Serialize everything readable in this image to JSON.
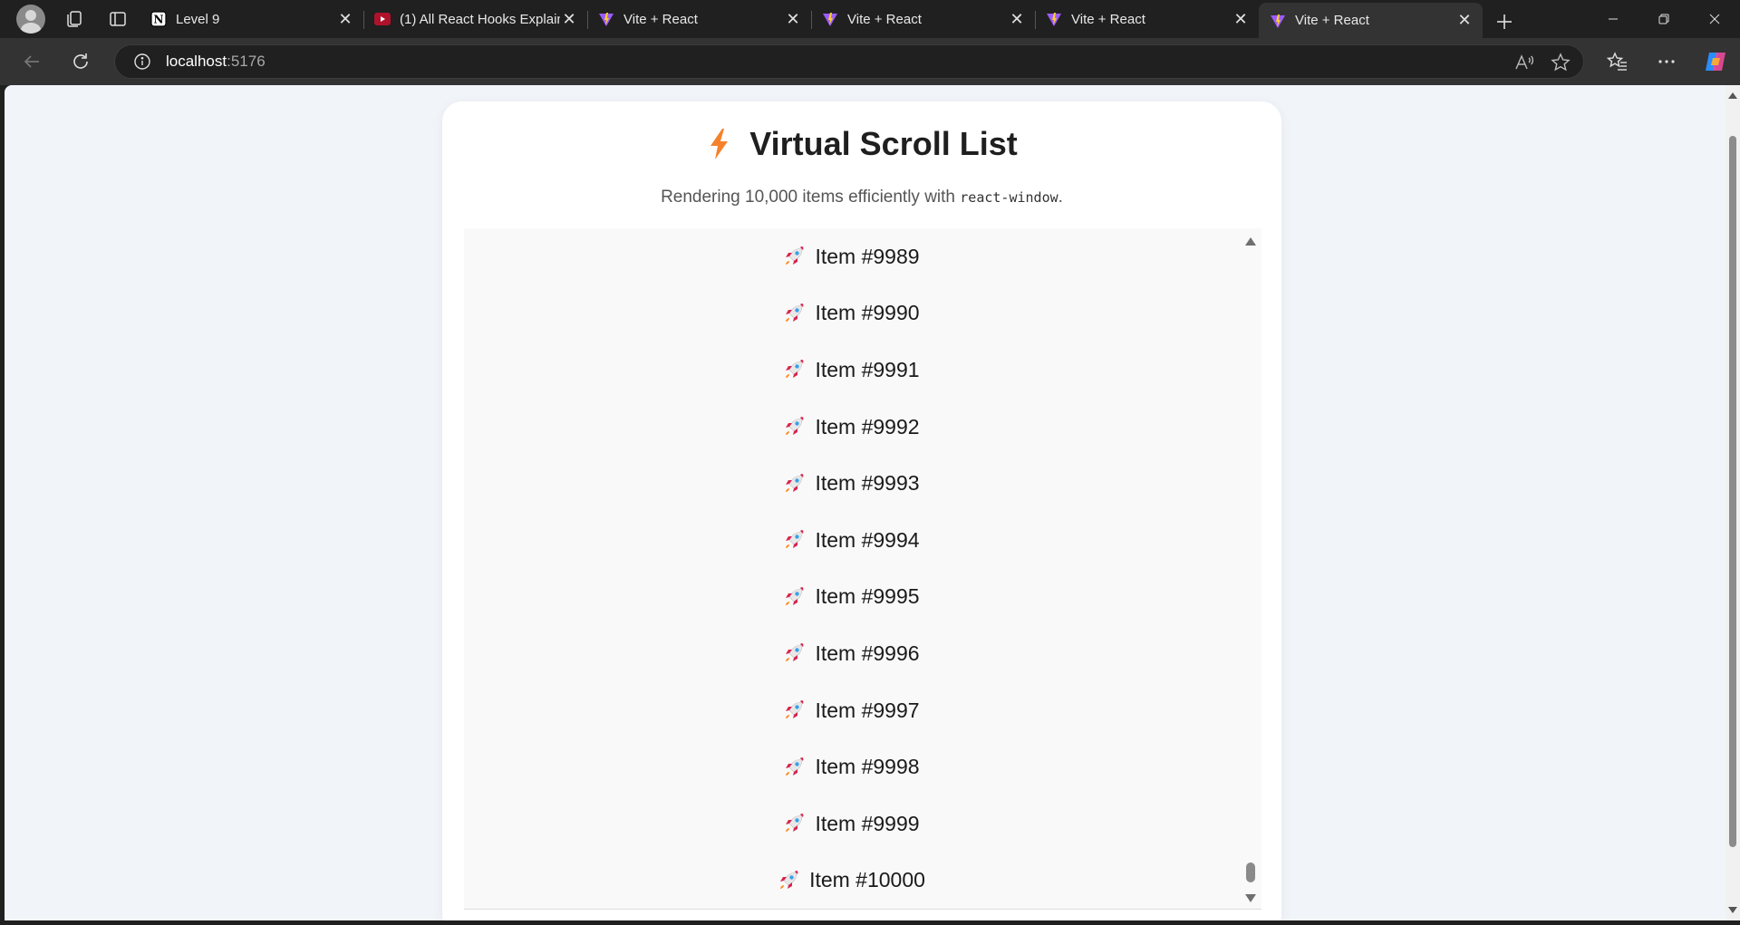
{
  "browser": {
    "tabs": [
      {
        "title": "Level 9",
        "favicon": "notion-icon",
        "active": false
      },
      {
        "title": "(1) All React Hooks Explain",
        "favicon": "youtube-icon",
        "active": false
      },
      {
        "title": "Vite + React",
        "favicon": "vite-icon",
        "active": false
      },
      {
        "title": "Vite + React",
        "favicon": "vite-icon",
        "active": false
      },
      {
        "title": "Vite + React",
        "favicon": "vite-icon",
        "active": false
      },
      {
        "title": "Vite + React",
        "favicon": "vite-icon",
        "active": true
      }
    ],
    "address": {
      "host": "localhost",
      "port": ":5176"
    }
  },
  "page": {
    "title": "Virtual Scroll List",
    "title_icon": "lightning-bolt-icon",
    "subtitle_text": "Rendering 10,000 items efficiently with ",
    "subtitle_code": "react-window",
    "subtitle_end": ".",
    "item_icon": "rocket-icon",
    "items": [
      "Item #9989",
      "Item #9990",
      "Item #9991",
      "Item #9992",
      "Item #9993",
      "Item #9994",
      "Item #9995",
      "Item #9996",
      "Item #9997",
      "Item #9998",
      "Item #9999",
      "Item #10000"
    ]
  },
  "colors": {
    "accent_bolt": "#f5822a",
    "page_background": "#f1f4f9",
    "card_background": "#ffffff",
    "list_background": "#f9f9f9"
  }
}
